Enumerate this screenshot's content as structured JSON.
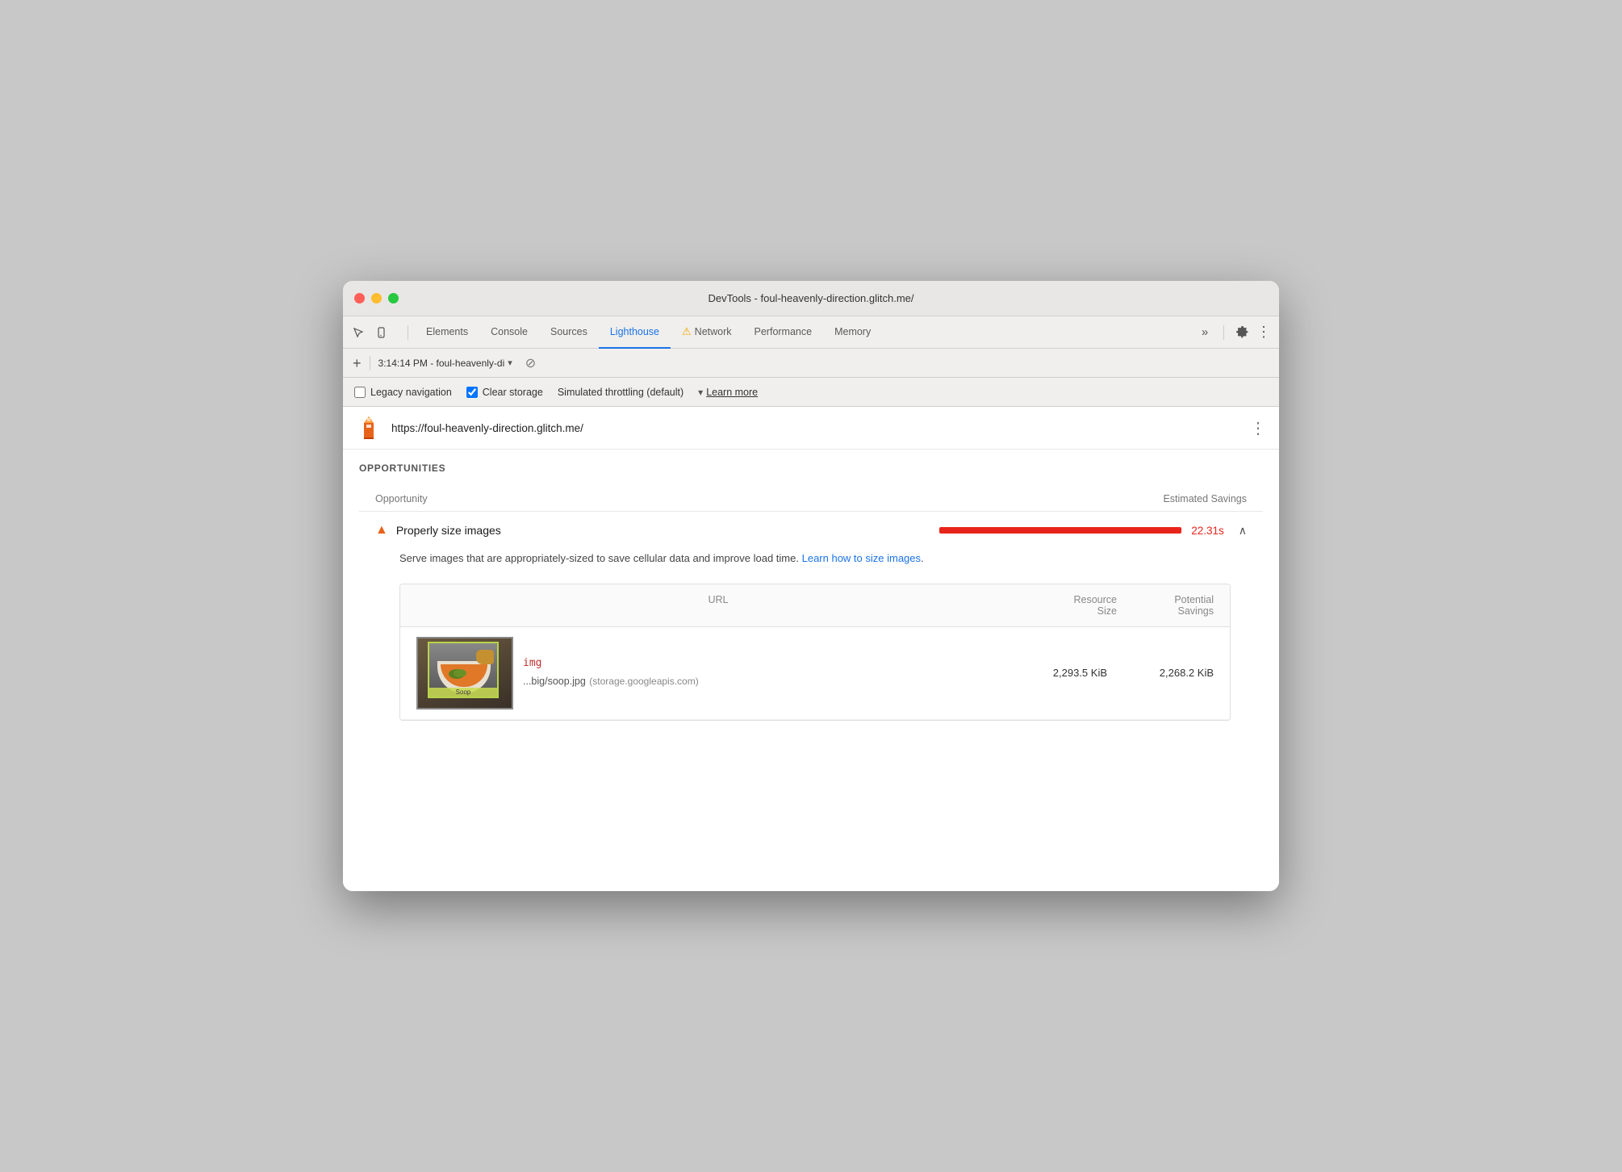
{
  "window": {
    "title": "DevTools - foul-heavenly-direction.glitch.me/"
  },
  "tabs_bar": {
    "icons": [
      "cursor-icon",
      "mobile-icon"
    ],
    "tabs": [
      {
        "id": "elements",
        "label": "Elements",
        "active": false
      },
      {
        "id": "console",
        "label": "Console",
        "active": false
      },
      {
        "id": "sources",
        "label": "Sources",
        "active": false
      },
      {
        "id": "lighthouse",
        "label": "Lighthouse",
        "active": true
      },
      {
        "id": "network",
        "label": "Network",
        "active": false,
        "warning": true
      },
      {
        "id": "performance",
        "label": "Performance",
        "active": false
      },
      {
        "id": "memory",
        "label": "Memory",
        "active": false
      }
    ],
    "more_label": "»",
    "settings_label": "⚙",
    "menu_label": "⋮"
  },
  "toolbar": {
    "add_label": "+",
    "session_text": "3:14:14 PM - foul-heavenly-di",
    "dropdown_symbol": "▾",
    "block_symbol": "⊘"
  },
  "options_bar": {
    "legacy_nav_label": "Legacy navigation",
    "legacy_nav_checked": false,
    "clear_storage_label": "Clear storage",
    "clear_storage_checked": true,
    "throttle_label": "Simulated throttling (default)",
    "dropdown_symbol": "▾",
    "learn_more_label": "Learn more"
  },
  "url_bar": {
    "url": "https://foul-heavenly-direction.glitch.me/",
    "more_symbol": "⋮"
  },
  "opportunities": {
    "title": "OPPORTUNITIES",
    "table_header_opportunity": "Opportunity",
    "table_header_savings": "Estimated Savings",
    "items": [
      {
        "id": "properly-size-images",
        "warning_icon": "▲",
        "name": "Properly size images",
        "savings_time": "22.31s",
        "expanded": true,
        "description": "Serve images that are appropriately-sized to save cellular data and improve load time.",
        "learn_link": "Learn how to size images",
        "detail_table": {
          "col_url": "URL",
          "col_resource": "Resource\nSize",
          "col_potential": "Potential\nSavings",
          "rows": [
            {
              "selector": "img",
              "filename": "...big/soop.jpg",
              "source": "(storage.googleapis.com)",
              "resource_size": "2,293.5 KiB",
              "potential_savings": "2,268.2 KiB",
              "thumb_label": "Soop"
            }
          ]
        }
      }
    ]
  }
}
